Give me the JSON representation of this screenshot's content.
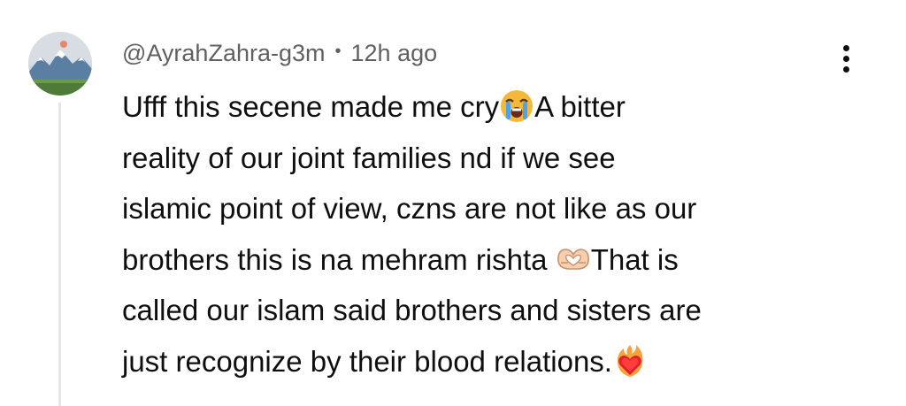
{
  "comment": {
    "author": "@AyrahZahra-g3m",
    "separator": "•",
    "timestamp": "12h ago",
    "body_lines": [
      [
        "Ufff this secene made me cry",
        "A bitter"
      ],
      [
        "reality of our joint families nd if we see"
      ],
      [
        "islamic point of view, czns are not like as our"
      ],
      [
        "brothers this is na mehram rishta ",
        "That is"
      ],
      [
        "called our islam said brothers and sisters are"
      ],
      [
        "just recognize by their blood relations."
      ]
    ],
    "emojis": [
      "loudly-crying-face-icon",
      "heart-hands-icon",
      "heart-on-fire-icon"
    ]
  },
  "colors": {
    "text": "#0f0f0f",
    "meta": "#606060",
    "thread_line": "#e5e5e5",
    "background": "#ffffff"
  }
}
